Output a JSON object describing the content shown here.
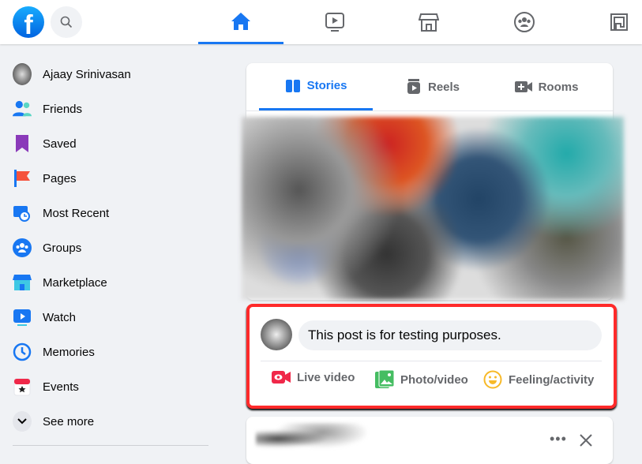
{
  "topbar": {
    "logo": "f",
    "nav": [
      {
        "icon": "home-icon",
        "active": true
      },
      {
        "icon": "watch-icon"
      },
      {
        "icon": "marketplace-icon"
      },
      {
        "icon": "groups-icon"
      },
      {
        "icon": "gaming-icon"
      }
    ]
  },
  "sidebar": {
    "items": [
      {
        "label": "Ajaay Srinivasan",
        "icon": "avatar"
      },
      {
        "label": "Friends",
        "icon": "friends-icon"
      },
      {
        "label": "Saved",
        "icon": "saved-icon"
      },
      {
        "label": "Pages",
        "icon": "pages-icon"
      },
      {
        "label": "Most Recent",
        "icon": "most-recent-icon"
      },
      {
        "label": "Groups",
        "icon": "groups-icon"
      },
      {
        "label": "Marketplace",
        "icon": "marketplace-icon"
      },
      {
        "label": "Watch",
        "icon": "watch-icon"
      },
      {
        "label": "Memories",
        "icon": "memories-icon"
      },
      {
        "label": "Events",
        "icon": "events-icon"
      },
      {
        "label": "See more",
        "icon": "chevron-down-icon"
      }
    ]
  },
  "stories": {
    "tabs": [
      {
        "label": "Stories",
        "active": true
      },
      {
        "label": "Reels"
      },
      {
        "label": "Rooms"
      }
    ]
  },
  "composer": {
    "text": "This post is for testing purposes.",
    "actions": [
      {
        "label": "Live video",
        "color": "#f02849"
      },
      {
        "label": "Photo/video",
        "color": "#45bd62"
      },
      {
        "label": "Feeling/activity",
        "color": "#f7b928"
      }
    ],
    "highlight_color": "#ff2a2a"
  },
  "accent": "#1877f2"
}
